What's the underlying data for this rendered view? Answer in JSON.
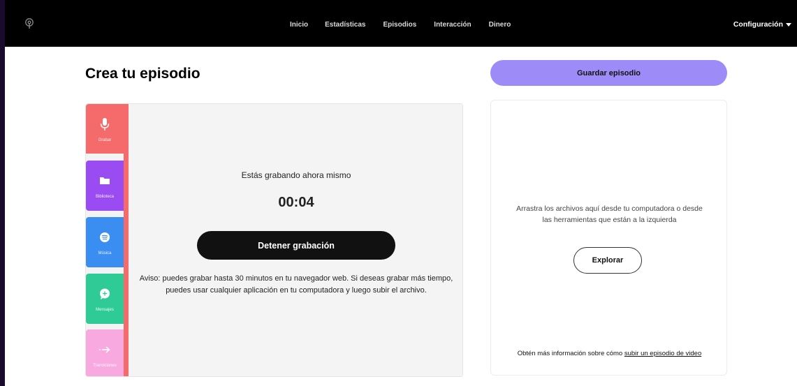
{
  "topbar": {
    "logo_icon": "podcast-icon",
    "nav": [
      "Inicio",
      "Estadísticas",
      "Episodios",
      "Interacción",
      "Dinero"
    ],
    "config_label": "Configuración"
  },
  "page": {
    "title": "Crea tu episodio",
    "save_button": "Guardar episodio"
  },
  "tools": [
    {
      "label": "Grabar",
      "icon": "microphone-icon",
      "color": "#f56a6a"
    },
    {
      "label": "Biblioteca",
      "icon": "folder-icon",
      "color": "#9a4cf2"
    },
    {
      "label": "Música",
      "icon": "spotify-icon",
      "color": "#3a8ef2"
    },
    {
      "label": "Mensajes",
      "icon": "message-plus-icon",
      "color": "#2fcb96"
    },
    {
      "label": "Transiciones",
      "icon": "arrow-right-icon",
      "color": "#f8a9e0"
    }
  ],
  "recorder": {
    "status": "Estás grabando ahora mismo",
    "timer": "00:04",
    "stop_button": "Detener grabación",
    "notice": "Aviso: puedes grabar hasta 30 minutos en tu navegador web. Si deseas grabar más tiempo, puedes usar cualquier aplicación en tu computadora y luego subir el archivo."
  },
  "dropzone": {
    "text": "Arrastra los archivos aquí desde tu computadora o desde las herramientas que están a la izquierda",
    "explore_button": "Explorar",
    "footer_prefix": "Obtén más información sobre cómo ",
    "footer_link": "subir un episodio de video"
  },
  "colors": {
    "accent": "#9d8cf7",
    "record": "#f56a6a"
  }
}
